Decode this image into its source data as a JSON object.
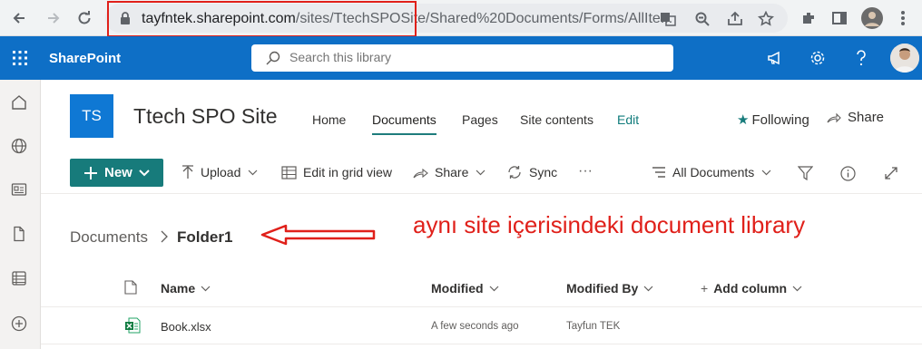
{
  "browser": {
    "url_host": "tayfntek.sharepoint.com",
    "url_path": "/sites/TtechSPOSite/Shared%20Documents/Forms/AllIte..."
  },
  "suitebar": {
    "brand": "SharePoint",
    "search_placeholder": "Search this library",
    "icons": [
      "waffle-icon",
      "megaphone-icon",
      "gear-icon",
      "help-icon"
    ]
  },
  "site": {
    "logo_initials": "TS",
    "title": "Ttech SPO Site",
    "nav": [
      {
        "label": "Home"
      },
      {
        "label": "Documents",
        "active": true
      },
      {
        "label": "Pages"
      },
      {
        "label": "Site contents"
      },
      {
        "label": "Edit"
      }
    ],
    "following_label": "Following",
    "share_label": "Share"
  },
  "commandbar": {
    "new_label": "New",
    "upload_label": "Upload",
    "grid_label": "Edit in grid view",
    "share_label": "Share",
    "sync_label": "Sync",
    "more_label": "···",
    "view_label": "All Documents"
  },
  "breadcrumb": {
    "root": "Documents",
    "current": "Folder1"
  },
  "annotation": {
    "text": "aynı site içerisindeki document library",
    "color": "#e0201a"
  },
  "list": {
    "columns": {
      "name": "Name",
      "modified": "Modified",
      "modified_by": "Modified By",
      "add_column": "Add column"
    },
    "rows": [
      {
        "name": "Book.xlsx",
        "modified": "A few seconds ago",
        "modified_by": "Tayfun TEK"
      }
    ]
  },
  "colors": {
    "suitebar": "#0e6fc6",
    "accent": "#177b7b",
    "logo": "#0f78d4"
  }
}
